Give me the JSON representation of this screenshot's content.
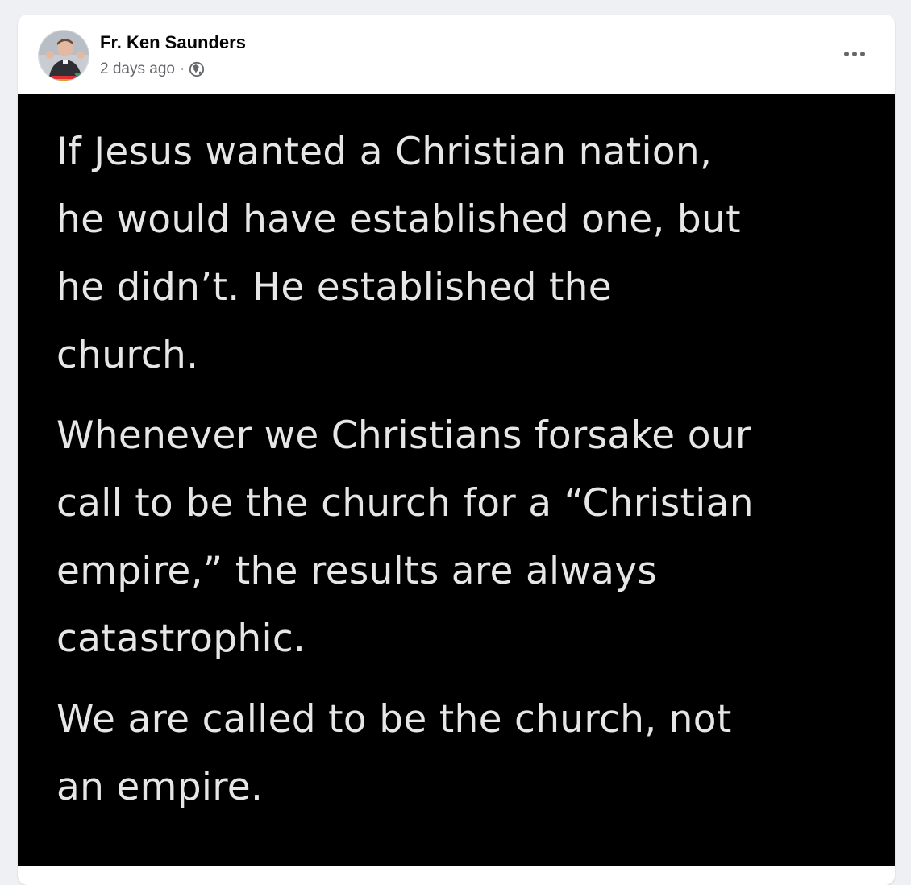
{
  "post": {
    "author": "Fr. Ken Saunders",
    "timestamp": "2 days ago",
    "separator": "·",
    "audience_icon": "globe-icon",
    "more_icon": "more-horizontal-icon",
    "image_text": {
      "paragraph1": [
        "If Jesus wanted a Christian nation,",
        "he would have established one, but",
        "he didn’t. He established the",
        "church."
      ],
      "paragraph2": [
        "Whenever we Christians forsake our",
        "call to be the church for a “Christian",
        "empire,” the results are always",
        "catastrophic."
      ],
      "paragraph3": [
        "We are called to be the church, not",
        "an empire."
      ]
    }
  },
  "colors": {
    "page_background": "#eef0f4",
    "card_background": "#ffffff",
    "author_text": "#050505",
    "meta_text": "#65676b",
    "image_background": "#000000",
    "image_text": "#e6e6e6"
  }
}
